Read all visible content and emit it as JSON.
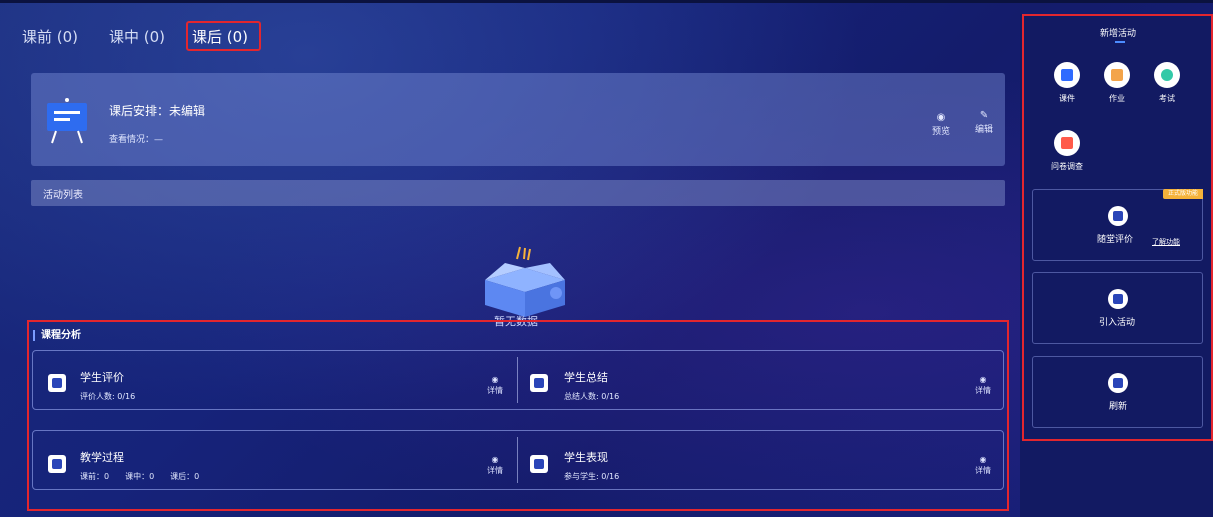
{
  "tabs": [
    {
      "label": "课前 (0)"
    },
    {
      "label": "课中 (0)"
    },
    {
      "label": "课后 (0)"
    }
  ],
  "summary": {
    "title": "课后安排：未编辑",
    "subtitle": "查看情况：—",
    "preview_label": "预览",
    "edit_label": "编辑"
  },
  "activity_list": {
    "title": "活动列表"
  },
  "empty_state": {
    "text": "暂无数据"
  },
  "analysis": {
    "title": "课程分析",
    "detail_label": "详情",
    "items": [
      {
        "title": "学生评价",
        "sub": "评价人数: 0/16"
      },
      {
        "title": "学生总结",
        "sub": "总结人数: 0/16"
      },
      {
        "title": "教学过程",
        "sub": "课前：0　　课中：0　　课后：0"
      },
      {
        "title": "学生表现",
        "sub": "参与学生: 0/16"
      }
    ]
  },
  "sidebar": {
    "title": "新增活动",
    "tools": [
      {
        "label": "课件",
        "color": "#2f6bff"
      },
      {
        "label": "作业",
        "color": "#f3a44a"
      },
      {
        "label": "考试",
        "color": "#33c9a8"
      },
      {
        "label": "问卷调查",
        "color": "#ff5a4a"
      }
    ],
    "eval": {
      "label": "随堂评价",
      "link": "了解功能",
      "tag": "正式版功能"
    },
    "import_label": "引入活动",
    "refresh_label": "刷新"
  }
}
